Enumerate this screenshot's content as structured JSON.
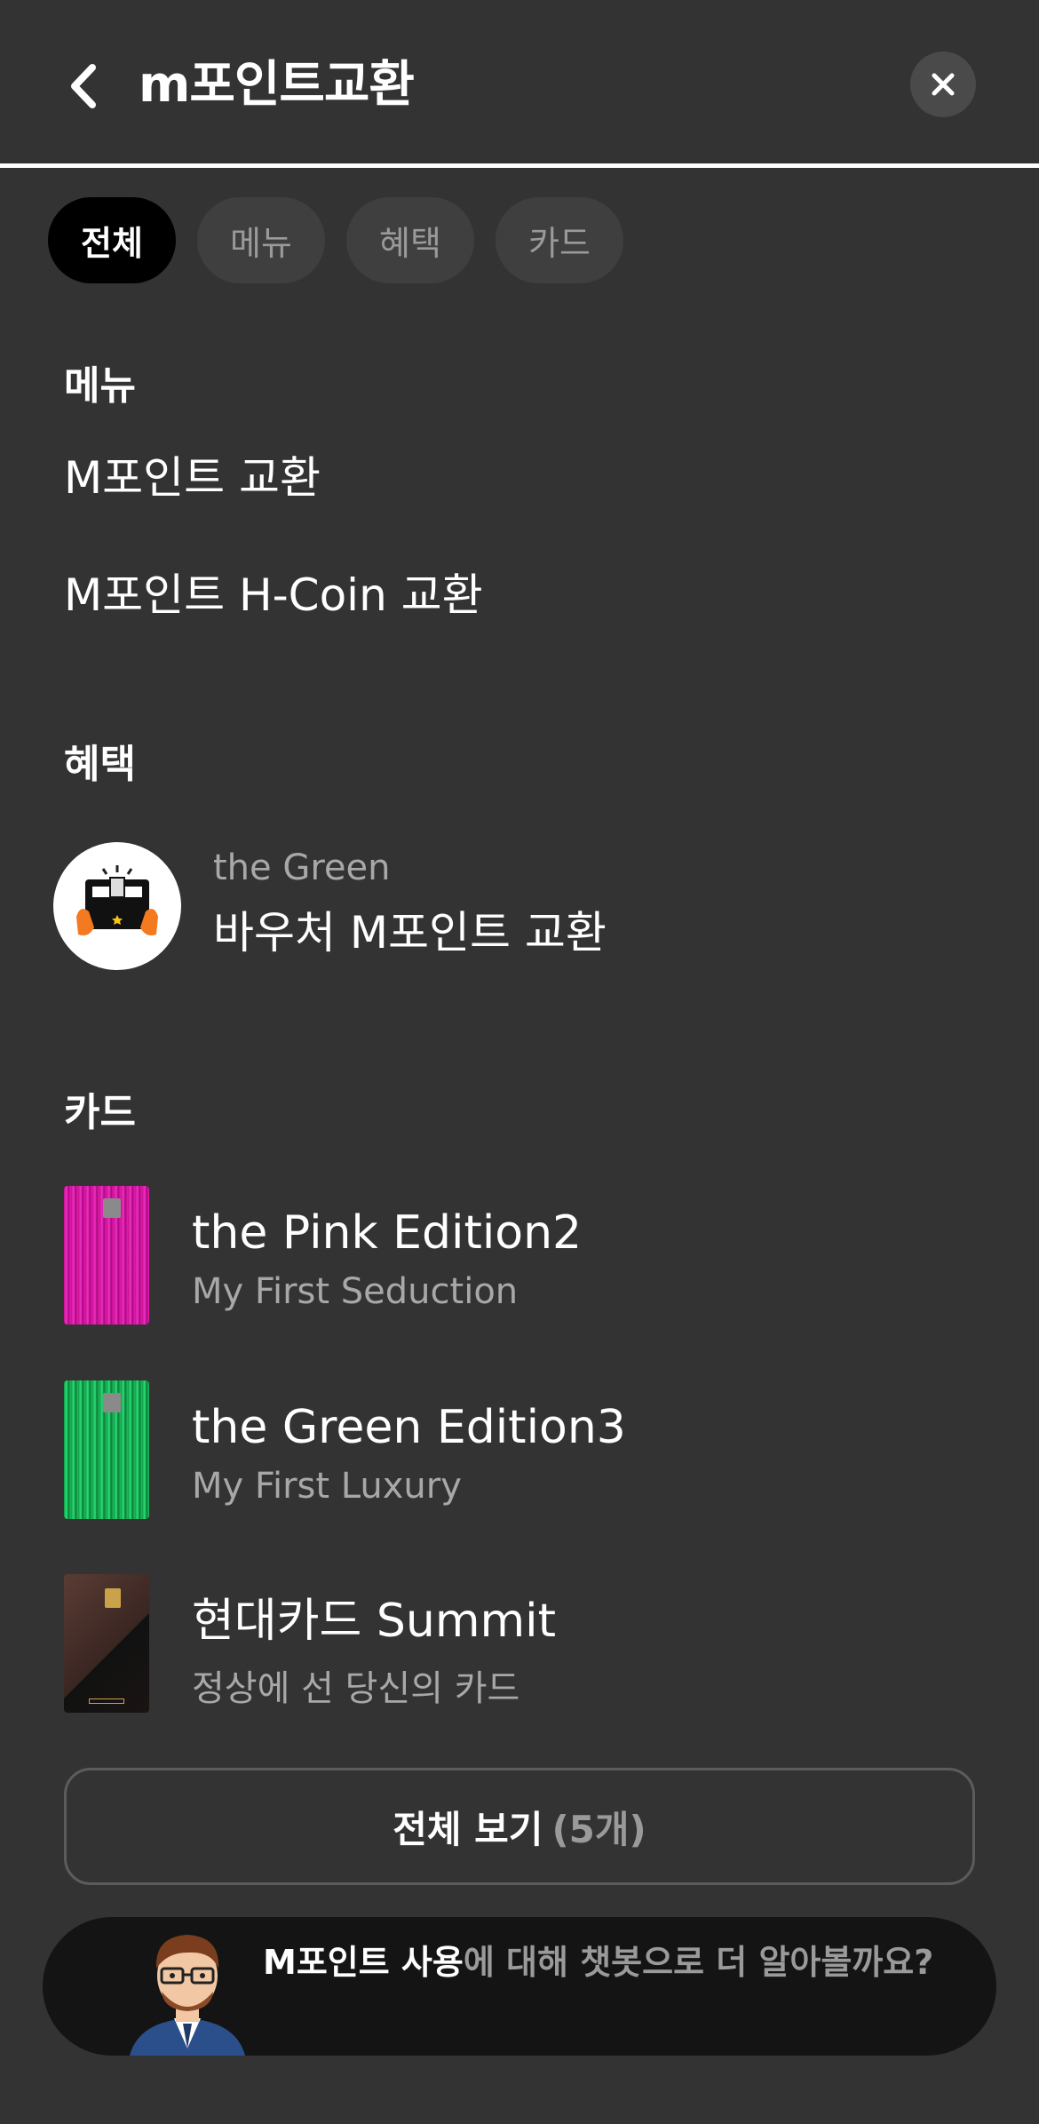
{
  "header": {
    "title": "m포인트교환",
    "back_icon": "chevron-left-icon",
    "close_icon": "close-icon"
  },
  "tabs": [
    {
      "label": "전체",
      "active": true
    },
    {
      "label": "메뉴",
      "active": false
    },
    {
      "label": "혜택",
      "active": false
    },
    {
      "label": "카드",
      "active": false
    }
  ],
  "menu_section": {
    "heading": "메뉴",
    "items": [
      {
        "label": "M포인트 교환"
      },
      {
        "label": "M포인트 H-Coin 교환"
      }
    ]
  },
  "benefit_section": {
    "heading": "혜택",
    "items": [
      {
        "subtitle": "the Green",
        "title": "바우처 M포인트 교환",
        "icon": "voucher-gift-icon"
      }
    ]
  },
  "card_section": {
    "heading": "카드",
    "items": [
      {
        "name": "the Pink Edition2",
        "tagline": "My First Seduction",
        "color": "#e01ab4"
      },
      {
        "name": "the Green Edition3",
        "tagline": "My First Luxury",
        "color": "#1db85a"
      },
      {
        "name": "현대카드 Summit",
        "tagline": "정상에 선 당신의 카드",
        "color": "#3a2a26"
      }
    ]
  },
  "view_all": {
    "label": "전체 보기",
    "count": "(5개)"
  },
  "chatbot": {
    "highlight": "M포인트 사용",
    "rest": "에 대해 챗봇으로 더 알아볼까요?",
    "avatar": "chatbot-avatar-icon"
  },
  "colors": {
    "background": "#333333",
    "tab_active": "#000000",
    "tab_inactive": "#3f3f3f",
    "chatbot_bg": "#141414"
  }
}
